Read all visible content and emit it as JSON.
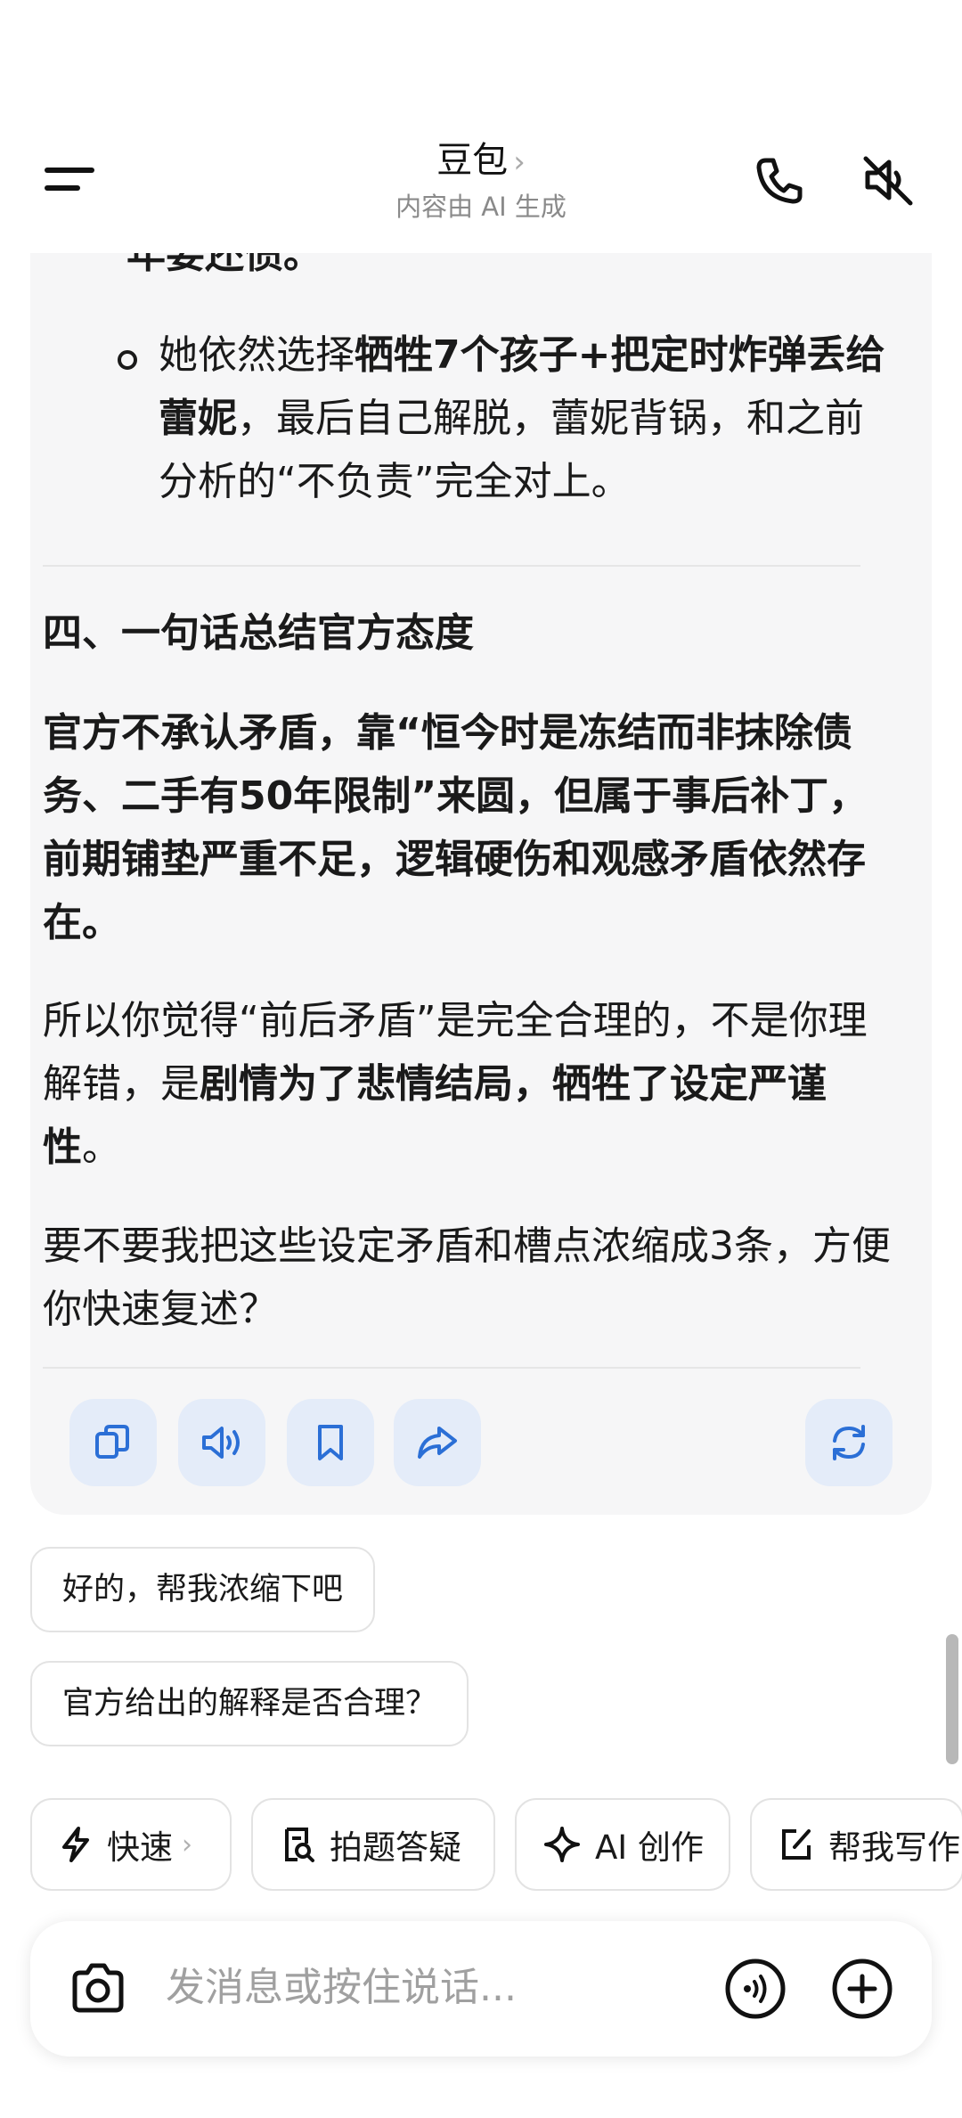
{
  "header": {
    "title": "豆包",
    "title_chevron": "›",
    "subtitle": "内容由 AI 生成",
    "icons": [
      "menu-icon",
      "phone-icon",
      "speaker-muted-icon"
    ]
  },
  "message": {
    "clipped_line": "年要还债。",
    "bullet": {
      "part1": "她依然选择",
      "bold1": "牺牲7个孩子+把定时炸弹丢给蕾妮",
      "part2": "，最后自己解脱，蕾妮背锅，和之前分析的“不负责”完全对上。"
    },
    "heading": "四、一句话总结官方态度",
    "summary_bold": "官方不承认矛盾，靠“恒今时是冻结而非抹除债务、二手有50年限制”来圆，但属于事后补丁，前期铺垫严重不足，逻辑硬伤和观感矛盾依然存在。",
    "para2": {
      "part1": "所以你觉得“前后矛盾”是完全合理的，不是你理解错，是",
      "bold": "剧情为了悲情结局，牺牲了设定严谨性",
      "part2": "。"
    },
    "para3": "要不要我把这些设定矛盾和槽点浓缩成3条，方便你快速复述？",
    "actions": [
      "copy-icon",
      "read-aloud-icon",
      "bookmark-icon",
      "share-icon",
      "regenerate-icon"
    ]
  },
  "suggestions": [
    "好的，帮我浓缩下吧",
    "官方给出的解释是否合理？"
  ],
  "chips": [
    {
      "label": "快速",
      "chevron": "›",
      "icon": "bolt-icon"
    },
    {
      "label": "拍题答疑",
      "icon": "photo-search-icon"
    },
    {
      "label": "AI 创作",
      "icon": "sparkle-icon"
    },
    {
      "label": "帮我写作",
      "icon": "edit-icon"
    }
  ],
  "input": {
    "placeholder": "发消息或按住说话..."
  },
  "colors": {
    "accent": "#2b6fd6",
    "action_bg": "#e4ecf9",
    "card_bg": "#f6f6f7"
  }
}
